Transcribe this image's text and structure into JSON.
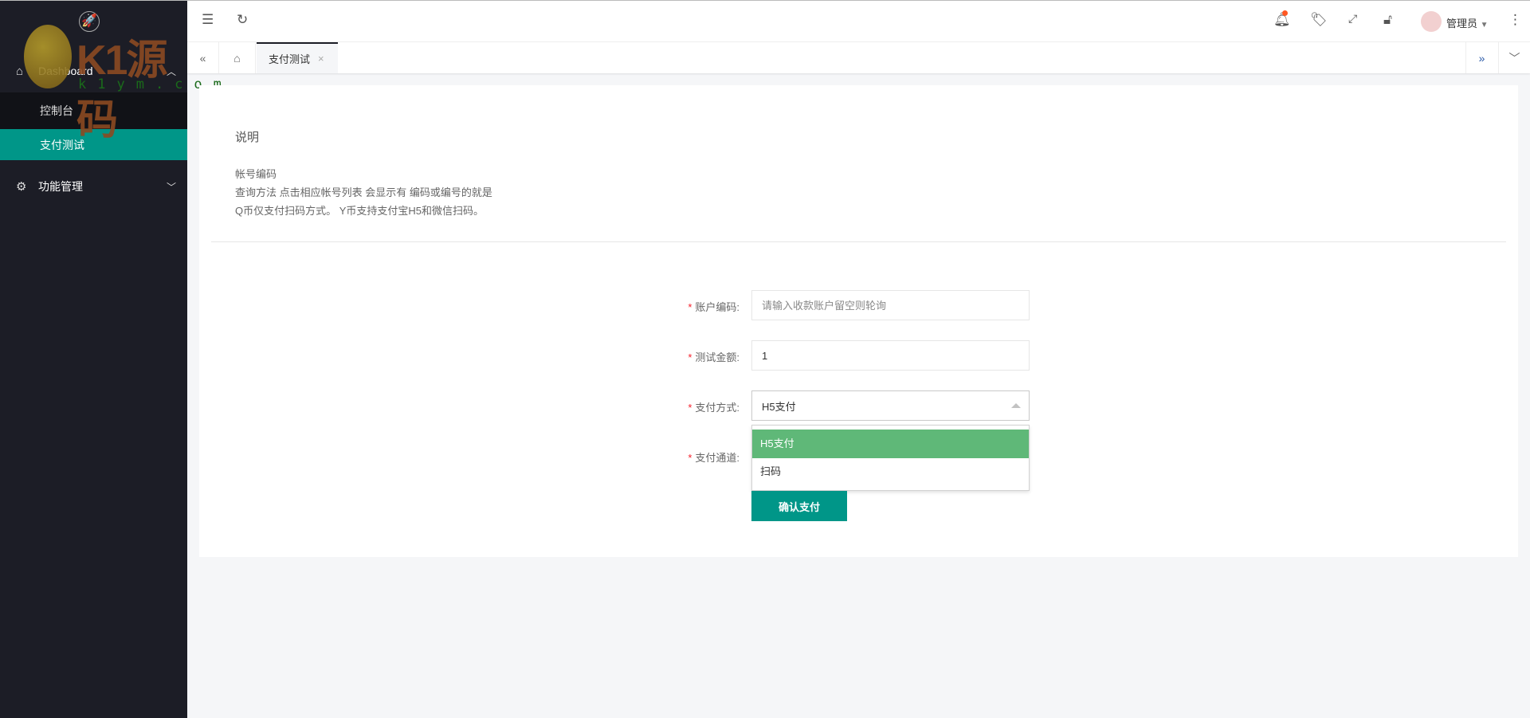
{
  "watermark": {
    "brand": "K1源码",
    "domain": "k1ym.com"
  },
  "sidebar": {
    "groups": [
      {
        "label": "Dashboard",
        "icon": "home-icon",
        "expanded": true,
        "items": [
          {
            "label": "控制台"
          },
          {
            "label": "支付测试",
            "active": true
          }
        ]
      },
      {
        "label": "功能管理",
        "icon": "gear-icon",
        "expanded": false
      }
    ]
  },
  "header": {
    "user": "管理员",
    "notification_dot": true
  },
  "tabs": [
    {
      "label": "支付测试",
      "active": true
    }
  ],
  "notes": {
    "title": "说明",
    "lines": [
      "帐号编码",
      "查询方法 点击相应帐号列表 会显示有 编码或编号的就是",
      "Q币仅支付扫码方式。 Y币支持支付宝H5和微信扫码。"
    ]
  },
  "form": {
    "account": {
      "label": "账户编码:",
      "placeholder": "请输入收款账户留空则轮询",
      "value": ""
    },
    "amount": {
      "label": "测试金额:",
      "value": "1"
    },
    "method": {
      "label": "支付方式:",
      "value": "H5支付",
      "options": [
        "H5支付",
        "扫码"
      ]
    },
    "channel": {
      "label": "支付通道:"
    },
    "submit": "确认支付"
  },
  "colors": {
    "accent": "#009688",
    "selected_option": "#5fb878",
    "sidebar": "#1c1d26"
  }
}
